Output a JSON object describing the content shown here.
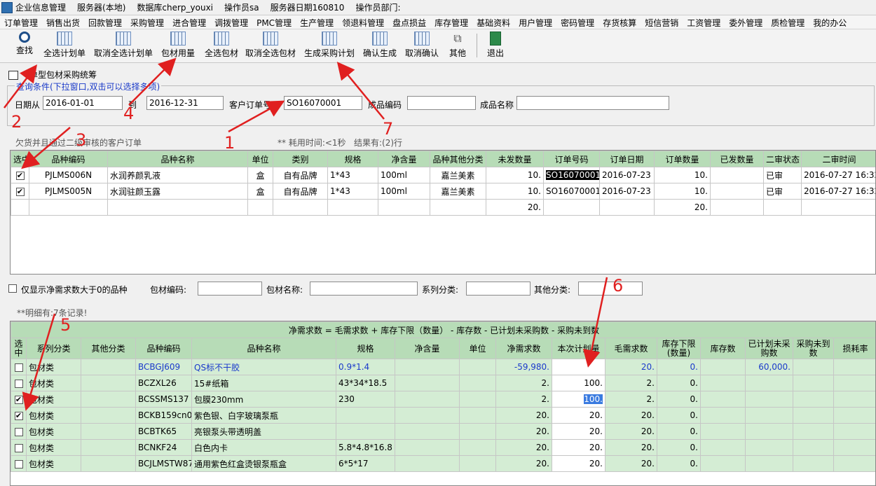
{
  "titlebar": {
    "items": [
      "企业信息管理",
      "服务器(本地)",
      "数据库cherp_youxi",
      "操作员sa",
      "服务器日期160810",
      "操作员部门:"
    ]
  },
  "menubar": {
    "items": [
      "订单管理",
      "销售出货",
      "回款管理",
      "采购管理",
      "进合管理",
      "调拨管理",
      "PMC管理",
      "生产管理",
      "领退料管理",
      "盘点损益",
      "库存管理",
      "基础资料",
      "用户管理",
      "密码管理",
      "存货核算",
      "短信营销",
      "工资管理",
      "委外管理",
      "质检管理",
      "我的办公"
    ]
  },
  "toolbar": {
    "find": "查找",
    "select_all_plan": "全选计划单",
    "cancel_select_plan": "取消全选计划单",
    "material_usage": "包材用量",
    "select_all_material": "全选包材",
    "cancel_select_material": "取消全选包材",
    "generate_purchase_plan": "生成采购计划",
    "confirm_generate": "确认生成",
    "cancel_confirm": "取消确认",
    "other": "其他",
    "exit": "退出"
  },
  "panel": {
    "title": "单型包材采购统筹",
    "query_legend": "查询条件(下拉窗口,双击可以选择多项)"
  },
  "query": {
    "date_from_label": "日期从",
    "date_from": "2016-01-01",
    "to_label": "到",
    "date_to": "2016-12-31",
    "order_no_label": "客户订单号码",
    "order_no": "SO16070001",
    "product_code_label": "成品编码",
    "product_code": "",
    "product_name_label": "成品名称",
    "product_name": ""
  },
  "section1": {
    "title": "欠货并且通过二级审核的客户订单",
    "elapsed": "** 耗用时间:<1秒",
    "result": "结果有:(2)行"
  },
  "orders": {
    "headers": [
      "选中",
      "品种编码",
      "品种名称",
      "单位",
      "类别",
      "规格",
      "净含量",
      "品种其他分类",
      "未发数量",
      "订单号码",
      "订单日期",
      "订单数量",
      "已发数量",
      "二审状态",
      "二审时间"
    ],
    "rows": [
      [
        "✔",
        "PJLMS006N",
        "水润养颜乳液",
        "盒",
        "自有品牌",
        "1*43",
        "100ml",
        "嘉兰美素",
        "10.",
        "SO16070001",
        "2016-07-23",
        "10.",
        "",
        "已审",
        "2016-07-27 16:32"
      ],
      [
        "✔",
        "PJLMS005N",
        "水润驻颜玉露",
        "盒",
        "自有品牌",
        "1*43",
        "100ml",
        "嘉兰美素",
        "10.",
        "SO16070001",
        "2016-07-23",
        "10.",
        "",
        "已审",
        "2016-07-27 16:32"
      ]
    ],
    "totals": {
      "unshipped": "20.",
      "order_qty": "20."
    }
  },
  "filter": {
    "only_positive_label": "仅显示净需求数大于0的品种",
    "code_label": "包材编码:",
    "name_label": "包材名称:",
    "series_label": "系列分类:",
    "other_label": "其他分类:"
  },
  "section2": {
    "title": "**明细有:7条记录!",
    "formula": "净需求数 = 毛需求数 + 库存下限（数量） - 库存数 - 已计划未采购数 - 采购未到数"
  },
  "materials": {
    "headers": [
      "选中",
      "系列分类",
      "其他分类",
      "品种编码",
      "品种名称",
      "规格",
      "净含量",
      "单位",
      "净需求数",
      "本次计划量",
      "毛需求数",
      "库存下限(数量)",
      "库存数",
      "已计划未采购数",
      "采购未到数",
      "损耗率"
    ],
    "rows": [
      [
        "",
        "包材类",
        "",
        "BCBGJ609",
        "QS标不干胶",
        "0.9*1.4",
        "",
        "",
        "-59,980.",
        "",
        "20.",
        "0.",
        "",
        "60,000.",
        "",
        ""
      ],
      [
        "",
        "包材类",
        "",
        "BCZXL26",
        "15#纸箱",
        "43*34*18.5",
        "",
        "",
        "2.",
        "100.",
        "2.",
        "0.",
        "",
        "",
        "",
        ""
      ],
      [
        "✔",
        "包材类",
        "",
        "BCSSMS137",
        "包膜230mm",
        "230",
        "",
        "",
        "2.",
        "100.",
        "2.",
        "0.",
        "",
        "",
        "",
        ""
      ],
      [
        "✔",
        "包材类",
        "",
        "BCKB159cn0(",
        "紫色银、白字玻璃泵瓶",
        "",
        "",
        "",
        "20.",
        "20.",
        "20.",
        "0.",
        "",
        "",
        "",
        ""
      ],
      [
        "",
        "包材类",
        "",
        "BCBTK65",
        "亮银泵头带透明盖",
        "",
        "",
        "",
        "20.",
        "20.",
        "20.",
        "0.",
        "",
        "",
        "",
        ""
      ],
      [
        "",
        "包材类",
        "",
        "BCNKF24",
        "白色内卡",
        "5.8*4.8*16.8",
        "",
        "",
        "20.",
        "20.",
        "20.",
        "0.",
        "",
        "",
        "",
        ""
      ],
      [
        "",
        "包材类",
        "",
        "BCJLMSTW87",
        "通用紫色红盒烫银泵瓶盒",
        "6*5*17",
        "",
        "",
        "20.",
        "20.",
        "20.",
        "0.",
        "",
        "",
        "",
        ""
      ]
    ]
  },
  "annotations": [
    "1",
    "2",
    "3",
    "4",
    "5",
    "6",
    "7"
  ],
  "colors": {
    "grid_header": "#b7dcb7",
    "grid_row": "#d4edd4",
    "annotation": "#e02020",
    "legend_blue": "#1838c8"
  }
}
